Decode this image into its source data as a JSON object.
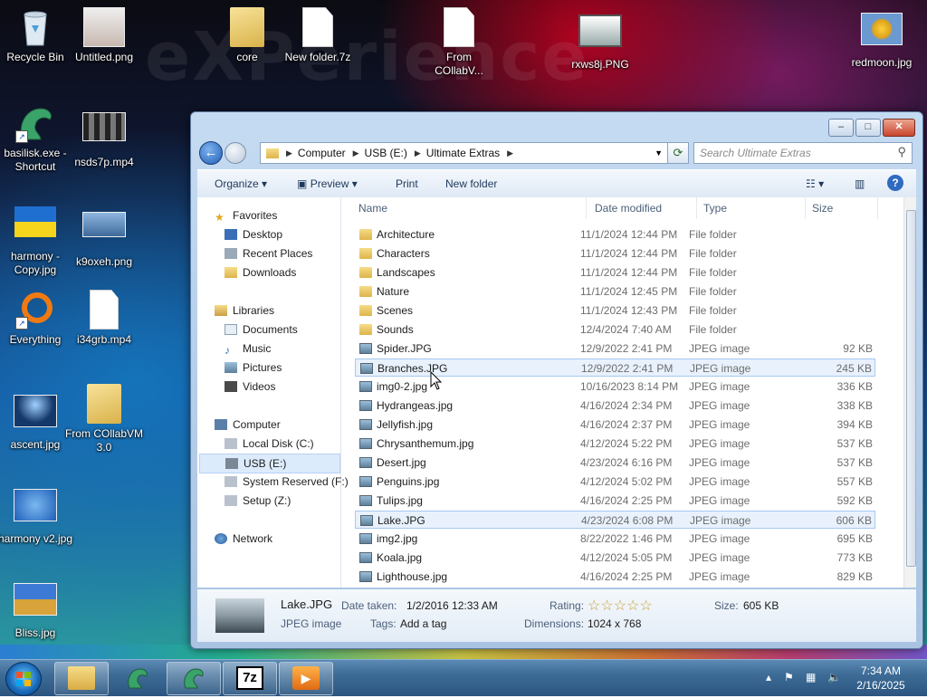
{
  "desktop": {
    "icons": [
      {
        "label": "Recycle Bin"
      },
      {
        "label": "Untitled.png"
      },
      {
        "label": "core"
      },
      {
        "label": "New folder.7z"
      },
      {
        "label": "From COllabV..."
      },
      {
        "label": "rxws8j.PNG"
      },
      {
        "label": "redmoon.jpg"
      },
      {
        "label": "basilisk.exe - Shortcut"
      },
      {
        "label": "nsds7p.mp4"
      },
      {
        "label": "harmony - Copy.jpg"
      },
      {
        "label": "k9oxeh.png"
      },
      {
        "label": "Everything"
      },
      {
        "label": "i34grb.mp4"
      },
      {
        "label": "ascent.jpg"
      },
      {
        "label": "From COllabVM 3.0"
      },
      {
        "label": "harmony v2.jpg"
      },
      {
        "label": "Bliss.jpg"
      }
    ],
    "watermark": "eXPerience"
  },
  "window": {
    "buttons": {
      "minimize": "–",
      "maximize": "□",
      "close": "✕"
    },
    "breadcrumb": [
      "Computer",
      "USB (E:)",
      "Ultimate Extras"
    ],
    "search_placeholder": "Search Ultimate Extras",
    "toolbar": {
      "organize": "Organize",
      "preview": "Preview",
      "print": "Print",
      "new_folder": "New folder"
    },
    "nav": {
      "favorites": "Favorites",
      "favorites_items": [
        "Desktop",
        "Recent Places",
        "Downloads"
      ],
      "libraries": "Libraries",
      "libraries_items": [
        "Documents",
        "Music",
        "Pictures",
        "Videos"
      ],
      "computer": "Computer",
      "computer_items": [
        "Local Disk (C:)",
        "USB (E:)",
        "System Reserved (F:)",
        "Setup (Z:)"
      ],
      "network": "Network"
    },
    "columns": {
      "name": "Name",
      "date": "Date modified",
      "type": "Type",
      "size": "Size"
    },
    "files": [
      {
        "name": "Architecture",
        "date": "11/1/2024 12:44 PM",
        "type": "File folder",
        "size": "",
        "kind": "folder"
      },
      {
        "name": "Characters",
        "date": "11/1/2024 12:44 PM",
        "type": "File folder",
        "size": "",
        "kind": "folder"
      },
      {
        "name": "Landscapes",
        "date": "11/1/2024 12:44 PM",
        "type": "File folder",
        "size": "",
        "kind": "folder"
      },
      {
        "name": "Nature",
        "date": "11/1/2024 12:45 PM",
        "type": "File folder",
        "size": "",
        "kind": "folder"
      },
      {
        "name": "Scenes",
        "date": "11/1/2024 12:43 PM",
        "type": "File folder",
        "size": "",
        "kind": "folder"
      },
      {
        "name": "Sounds",
        "date": "12/4/2024 7:40 AM",
        "type": "File folder",
        "size": "",
        "kind": "folder"
      },
      {
        "name": "Spider.JPG",
        "date": "12/9/2022 2:41 PM",
        "type": "JPEG image",
        "size": "92 KB",
        "kind": "img"
      },
      {
        "name": "Branches.JPG",
        "date": "12/9/2022 2:41 PM",
        "type": "JPEG image",
        "size": "245 KB",
        "kind": "img"
      },
      {
        "name": "img0-2.jpg",
        "date": "10/16/2023 8:14 PM",
        "type": "JPEG image",
        "size": "336 KB",
        "kind": "img"
      },
      {
        "name": "Hydrangeas.jpg",
        "date": "4/16/2024 2:34 PM",
        "type": "JPEG image",
        "size": "338 KB",
        "kind": "img"
      },
      {
        "name": "Jellyfish.jpg",
        "date": "4/16/2024 2:37 PM",
        "type": "JPEG image",
        "size": "394 KB",
        "kind": "img"
      },
      {
        "name": "Chrysanthemum.jpg",
        "date": "4/12/2024 5:22 PM",
        "type": "JPEG image",
        "size": "537 KB",
        "kind": "img"
      },
      {
        "name": "Desert.jpg",
        "date": "4/23/2024 6:16 PM",
        "type": "JPEG image",
        "size": "537 KB",
        "kind": "img"
      },
      {
        "name": "Penguins.jpg",
        "date": "4/12/2024 5:02 PM",
        "type": "JPEG image",
        "size": "557 KB",
        "kind": "img"
      },
      {
        "name": "Tulips.jpg",
        "date": "4/16/2024 2:25 PM",
        "type": "JPEG image",
        "size": "592 KB",
        "kind": "img"
      },
      {
        "name": "Lake.JPG",
        "date": "4/23/2024 6:08 PM",
        "type": "JPEG image",
        "size": "606 KB",
        "kind": "img"
      },
      {
        "name": "img2.jpg",
        "date": "8/22/2022 1:46 PM",
        "type": "JPEG image",
        "size": "695 KB",
        "kind": "img"
      },
      {
        "name": "Koala.jpg",
        "date": "4/12/2024 5:05 PM",
        "type": "JPEG image",
        "size": "773 KB",
        "kind": "img"
      },
      {
        "name": "Lighthouse.jpg",
        "date": "4/16/2024 2:25 PM",
        "type": "JPEG image",
        "size": "829 KB",
        "kind": "img"
      }
    ],
    "details": {
      "name": "Lake.JPG",
      "type": "JPEG image",
      "date_label": "Date taken:",
      "date_value": "1/2/2016 12:33 AM",
      "tags_label": "Tags:",
      "tags_value": "Add a tag",
      "rating_label": "Rating:",
      "rating_stars": "☆☆☆☆☆",
      "dimensions_label": "Dimensions:",
      "dimensions_value": "1024 x 768",
      "size_label": "Size:",
      "size_value": "605 KB"
    }
  },
  "taskbar": {
    "apps": [
      "explorer",
      "basilisk",
      "basilisk-2",
      "7-zip",
      "media-player"
    ],
    "sevenzip_label": "7z",
    "time": "7:34 AM",
    "date": "2/16/2025"
  }
}
